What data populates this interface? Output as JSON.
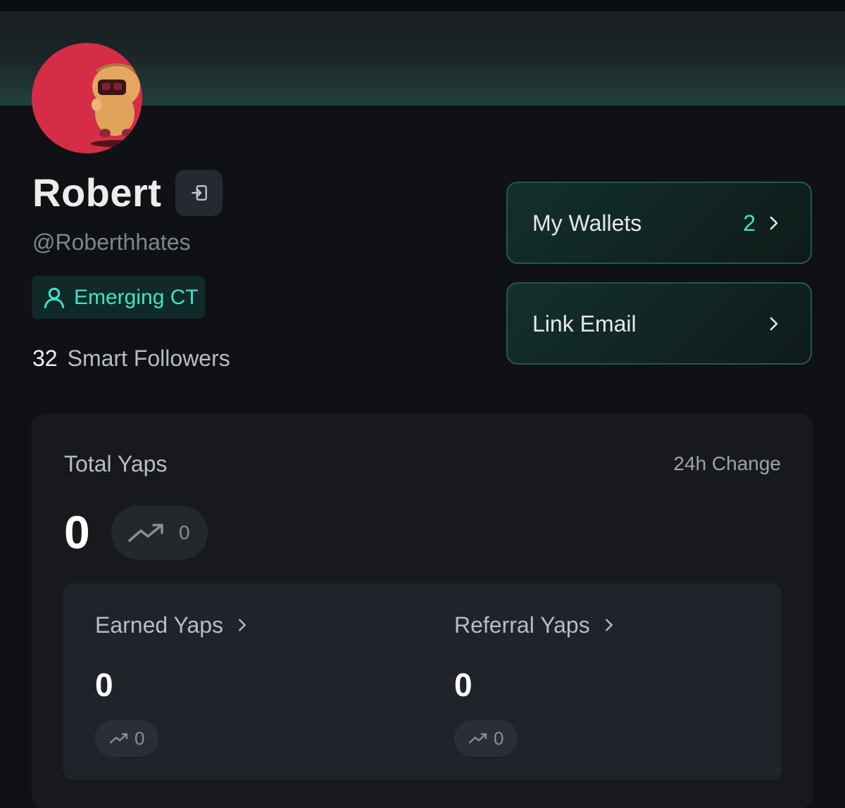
{
  "profile": {
    "name": "Robert",
    "handle": "@Roberthhates",
    "badge": "Emerging CT",
    "smart_followers_count": "32",
    "smart_followers_label": "Smart Followers"
  },
  "actions": {
    "wallets_label": "My Wallets",
    "wallets_count": "2",
    "email_label": "Link Email"
  },
  "yaps": {
    "total_label": "Total Yaps",
    "change_label": "24h Change",
    "total_value": "0",
    "total_change": "0",
    "earned_label": "Earned Yaps",
    "earned_value": "0",
    "earned_change": "0",
    "referral_label": "Referral Yaps",
    "referral_value": "0",
    "referral_change": "0"
  },
  "colors": {
    "accent": "#3fe3c9",
    "background": "#0f1115",
    "avatar_bg": "#d52d45"
  },
  "icons": {
    "logout": "logout-icon",
    "badge": "user-icon",
    "chevron": "chevron-right-icon",
    "trend": "trending-up-icon"
  }
}
